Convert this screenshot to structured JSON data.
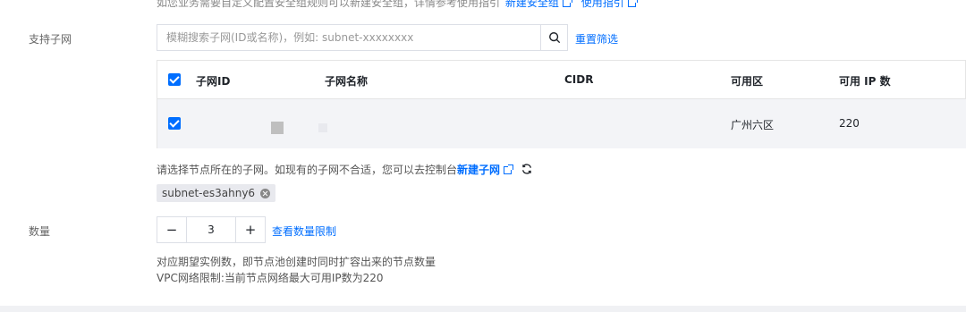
{
  "top_note": {
    "text": "如您业务需要自定义配置安全组规则可以新建安全组，详情参考使用指引",
    "link1": "新建安全组",
    "link2": "使用指引"
  },
  "subnet": {
    "label": "支持子网",
    "search_placeholder": "模糊搜索子网(ID或名称)，例如: subnet-xxxxxxxx",
    "search_icon": "search-icon",
    "reset_label": "重置筛选",
    "table": {
      "headers": [
        "子网ID",
        "子网名称",
        "CIDR",
        "可用区",
        "可用 IP 数"
      ],
      "rows": [
        {
          "checked": true,
          "subnet_id": "",
          "subnet_name": "",
          "cidr": "",
          "zone": "广州六区",
          "available_ips": "220"
        }
      ]
    },
    "hint_text": "请选择节点所在的子网。如现有的子网不合适，您可以去控制台",
    "hint_link": "新建子网",
    "refresh_icon": "refresh-icon",
    "selected_tag": "subnet-es3ahny6"
  },
  "quantity": {
    "label": "数量",
    "minus": "−",
    "value": "3",
    "plus": "+",
    "limit_link": "查看数量限制",
    "desc1": "对应期望实例数，即节点池创建时同时扩容出来的节点数量",
    "desc2": "VPC网络限制:当前节点网络最大可用IP数为220"
  },
  "colors": {
    "accent": "#006eff",
    "row_bg": "#f3f4f7"
  }
}
